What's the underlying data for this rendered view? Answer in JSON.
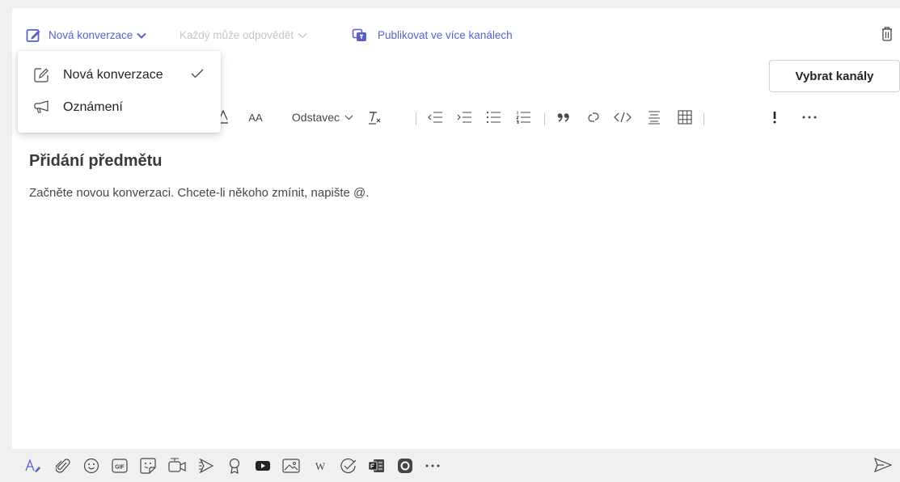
{
  "topbar": {
    "new_conversation": "Nová konverzace",
    "everyone_can_reply": "Každý může odpovědět",
    "post_multiple": "Publikovat ve více kanálech",
    "select_channels": "Vybrat kanály"
  },
  "dropdown": {
    "items": [
      {
        "label": "Nová konverzace",
        "icon": "edit-icon",
        "selected": true
      },
      {
        "label": "Oznámení",
        "icon": "megaphone-icon",
        "selected": false
      }
    ]
  },
  "format_toolbar": {
    "paragraph_label": "Odstavec",
    "font_size_label": "AA"
  },
  "compose": {
    "subject_placeholder": "Přidání předmětu",
    "body_placeholder": "Začněte novou konverzaci. Chcete-li někoho zmínit, napište @."
  },
  "bottom_toolbar": {
    "icons": [
      "format-icon",
      "attach-icon",
      "emoji-icon",
      "gif-icon",
      "sticker-icon",
      "meet-now-icon",
      "stream-icon",
      "praise-icon",
      "youtube-icon",
      "image-icon",
      "wiki-icon",
      "approvals-icon",
      "forms-icon",
      "loop-icon",
      "more-icon"
    ],
    "gif_label": "GIF",
    "wiki_label": "W"
  },
  "colors": {
    "accent": "#5b5fc7",
    "muted": "#c8c6c4",
    "background": "#f0f0f0"
  }
}
